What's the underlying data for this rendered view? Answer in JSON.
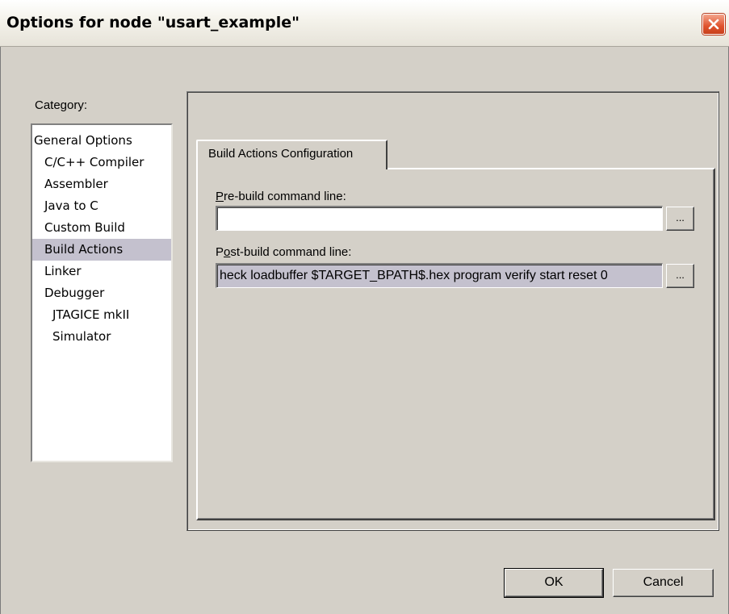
{
  "window": {
    "title": "Options for node \"usart_example\""
  },
  "category": {
    "label": "Category:",
    "items": [
      {
        "label": "General Options",
        "level": 0,
        "selected": false
      },
      {
        "label": "C/C++ Compiler",
        "level": 1,
        "selected": false
      },
      {
        "label": "Assembler",
        "level": 1,
        "selected": false
      },
      {
        "label": "Java to C",
        "level": 1,
        "selected": false
      },
      {
        "label": "Custom Build",
        "level": 1,
        "selected": false
      },
      {
        "label": "Build Actions",
        "level": 1,
        "selected": true
      },
      {
        "label": "Linker",
        "level": 1,
        "selected": false
      },
      {
        "label": "Debugger",
        "level": 1,
        "selected": false
      },
      {
        "label": "JTAGICE mkII",
        "level": 2,
        "selected": false
      },
      {
        "label": "Simulator",
        "level": 2,
        "selected": false
      }
    ]
  },
  "tabs": [
    {
      "label": "Build Actions Configuration",
      "active": true
    }
  ],
  "prebuild": {
    "label_accel": "P",
    "label_rest": "re-build command line:",
    "value": "",
    "browse_label": "..."
  },
  "postbuild": {
    "label_pre": "P",
    "label_accel": "o",
    "label_rest": "st-build command line:",
    "value": "heck loadbuffer $TARGET_BPATH$.hex program verify start reset 0",
    "browse_label": "..."
  },
  "buttons": {
    "ok": "OK",
    "cancel": "Cancel"
  },
  "colors": {
    "dialog_bg": "#d4d0c8",
    "selection_bg": "#c4c1ce",
    "close_button": "#e0532e"
  }
}
